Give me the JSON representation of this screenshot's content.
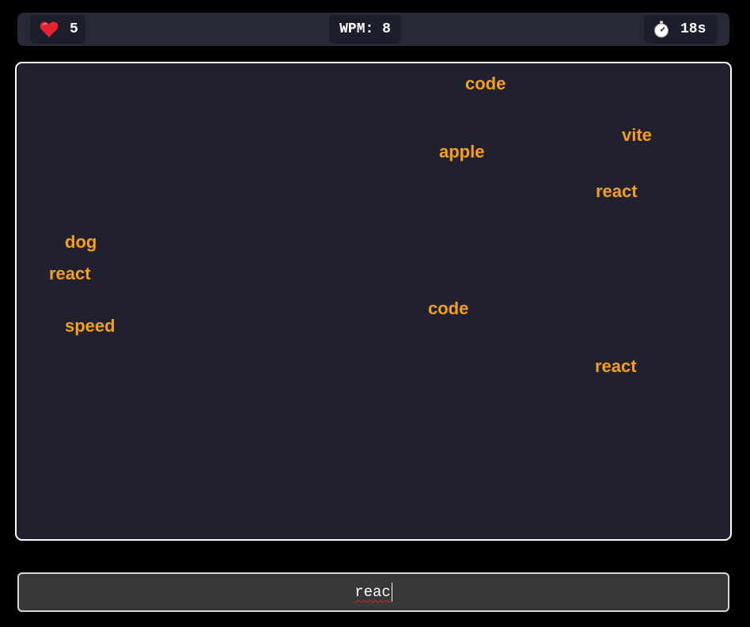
{
  "hud": {
    "lives_icon": "heart-icon",
    "lives": "5",
    "wpm": "WPM: 8",
    "timer_icon": "stopwatch-icon",
    "timer": "18s"
  },
  "board": {
    "words": [
      "code",
      "vite",
      "apple",
      "react",
      "dog",
      "react",
      "code",
      "speed",
      "react"
    ]
  },
  "input": {
    "value": "reac"
  },
  "colors": {
    "word": "#f5a016",
    "board_bg": "#20202f",
    "hud_bg": "#272838",
    "input_bg": "#383838"
  }
}
